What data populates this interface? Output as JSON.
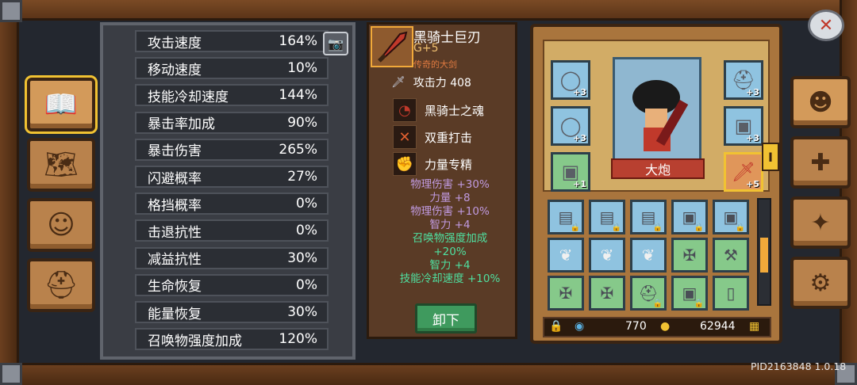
{
  "stats": [
    {
      "label": "攻击速度",
      "value": "164%"
    },
    {
      "label": "移动速度",
      "value": "10%"
    },
    {
      "label": "技能冷却速度",
      "value": "144%"
    },
    {
      "label": "暴击率加成",
      "value": "90%"
    },
    {
      "label": "暴击伤害",
      "value": "265%"
    },
    {
      "label": "闪避概率",
      "value": "27%"
    },
    {
      "label": "格挡概率",
      "value": "0%"
    },
    {
      "label": "击退抗性",
      "value": "0%"
    },
    {
      "label": "减益抗性",
      "value": "30%"
    },
    {
      "label": "生命恢复",
      "value": "0%"
    },
    {
      "label": "能量恢复",
      "value": "30%"
    },
    {
      "label": "召唤物强度加成",
      "value": "120%"
    }
  ],
  "item": {
    "name": "黑骑士巨刃",
    "grade": "G+5",
    "rarity": "传奇的大剑",
    "attack_label": "攻击力 408",
    "skills": [
      {
        "label": "黑骑士之魂",
        "icon": "soul-icon"
      },
      {
        "label": "双重打击",
        "icon": "double-strike-icon"
      },
      {
        "label": "力量专精",
        "icon": "strength-icon"
      }
    ],
    "bonuses": [
      {
        "text": "物理伤害 +30%",
        "color": "purple"
      },
      {
        "text": "力量 +8",
        "color": "purple"
      },
      {
        "text": "物理伤害 +10%",
        "color": "purple"
      },
      {
        "text": "智力 +4",
        "color": "purple"
      },
      {
        "text": "召唤物强度加成",
        "color": "green"
      },
      {
        "text": "+20%",
        "color": "green"
      },
      {
        "text": "智力 +4",
        "color": "green"
      },
      {
        "text": "技能冷却速度 +10%",
        "color": "green"
      }
    ],
    "unequip_label": "卸下"
  },
  "equipment": {
    "character_name": "大炮",
    "slots": [
      {
        "id": "ring-1",
        "badge": "+3",
        "color": "blue",
        "icon": "ring-icon"
      },
      {
        "id": "ring-2",
        "badge": "+3",
        "color": "blue",
        "icon": "ring-icon"
      },
      {
        "id": "armor-1",
        "badge": "+1",
        "color": "green",
        "icon": "armor-icon"
      },
      {
        "id": "helmet-1",
        "badge": "+3",
        "color": "blue",
        "icon": "helmet-icon"
      },
      {
        "id": "armor-2",
        "badge": "+3",
        "color": "blue",
        "icon": "armor-icon"
      },
      {
        "id": "weapon",
        "badge": "+5",
        "color": "orange",
        "icon": "sword-icon"
      }
    ],
    "side_marker": "I"
  },
  "inventory": {
    "slots": [
      {
        "icon": "chest-icon",
        "color": "blue",
        "locked": true
      },
      {
        "icon": "chest-icon",
        "color": "blue",
        "locked": true
      },
      {
        "icon": "chest-icon",
        "color": "blue",
        "locked": true
      },
      {
        "icon": "armor-icon",
        "color": "blue",
        "locked": true
      },
      {
        "icon": "armor-icon",
        "color": "blue",
        "locked": true
      },
      {
        "icon": "feather-icon",
        "color": "blue",
        "locked": false
      },
      {
        "icon": "feather-icon",
        "color": "blue",
        "locked": false
      },
      {
        "icon": "feather-icon",
        "color": "blue",
        "locked": false
      },
      {
        "icon": "crossbow-icon",
        "color": "green",
        "locked": false
      },
      {
        "icon": "axe-icon",
        "color": "green",
        "locked": false
      },
      {
        "icon": "crossbow-icon",
        "color": "green",
        "locked": false
      },
      {
        "icon": "crossbow-icon",
        "color": "green",
        "locked": false
      },
      {
        "icon": "helmet-icon",
        "color": "green",
        "locked": true
      },
      {
        "icon": "armor-icon",
        "color": "green",
        "locked": true
      },
      {
        "icon": "potion-icon",
        "color": "green",
        "locked": false
      }
    ],
    "scroll_position": 0.55
  },
  "currency": {
    "gems": "770",
    "gold": "62944"
  },
  "version": "PID2163848 1.0.18",
  "left_tabs": [
    {
      "name": "tab-book",
      "icon": "book-icon",
      "glyph": "📖",
      "active": true
    },
    {
      "name": "tab-map",
      "icon": "map-icon",
      "glyph": "🗺",
      "active": false
    },
    {
      "name": "tab-emotes",
      "icon": "emote-icon",
      "glyph": "☺",
      "active": false
    },
    {
      "name": "tab-helmet",
      "icon": "helmet-icon",
      "glyph": "⛑",
      "active": false
    }
  ],
  "right_tabs": [
    {
      "name": "tab-character",
      "icon": "face-icon",
      "glyph": "☻",
      "active": true
    },
    {
      "name": "tab-skills",
      "icon": "skills-icon",
      "glyph": "✚",
      "active": false
    },
    {
      "name": "tab-talents",
      "icon": "star-icon",
      "glyph": "✦",
      "active": false
    },
    {
      "name": "tab-settings",
      "icon": "gear-icon",
      "glyph": "⚙",
      "active": false
    }
  ]
}
